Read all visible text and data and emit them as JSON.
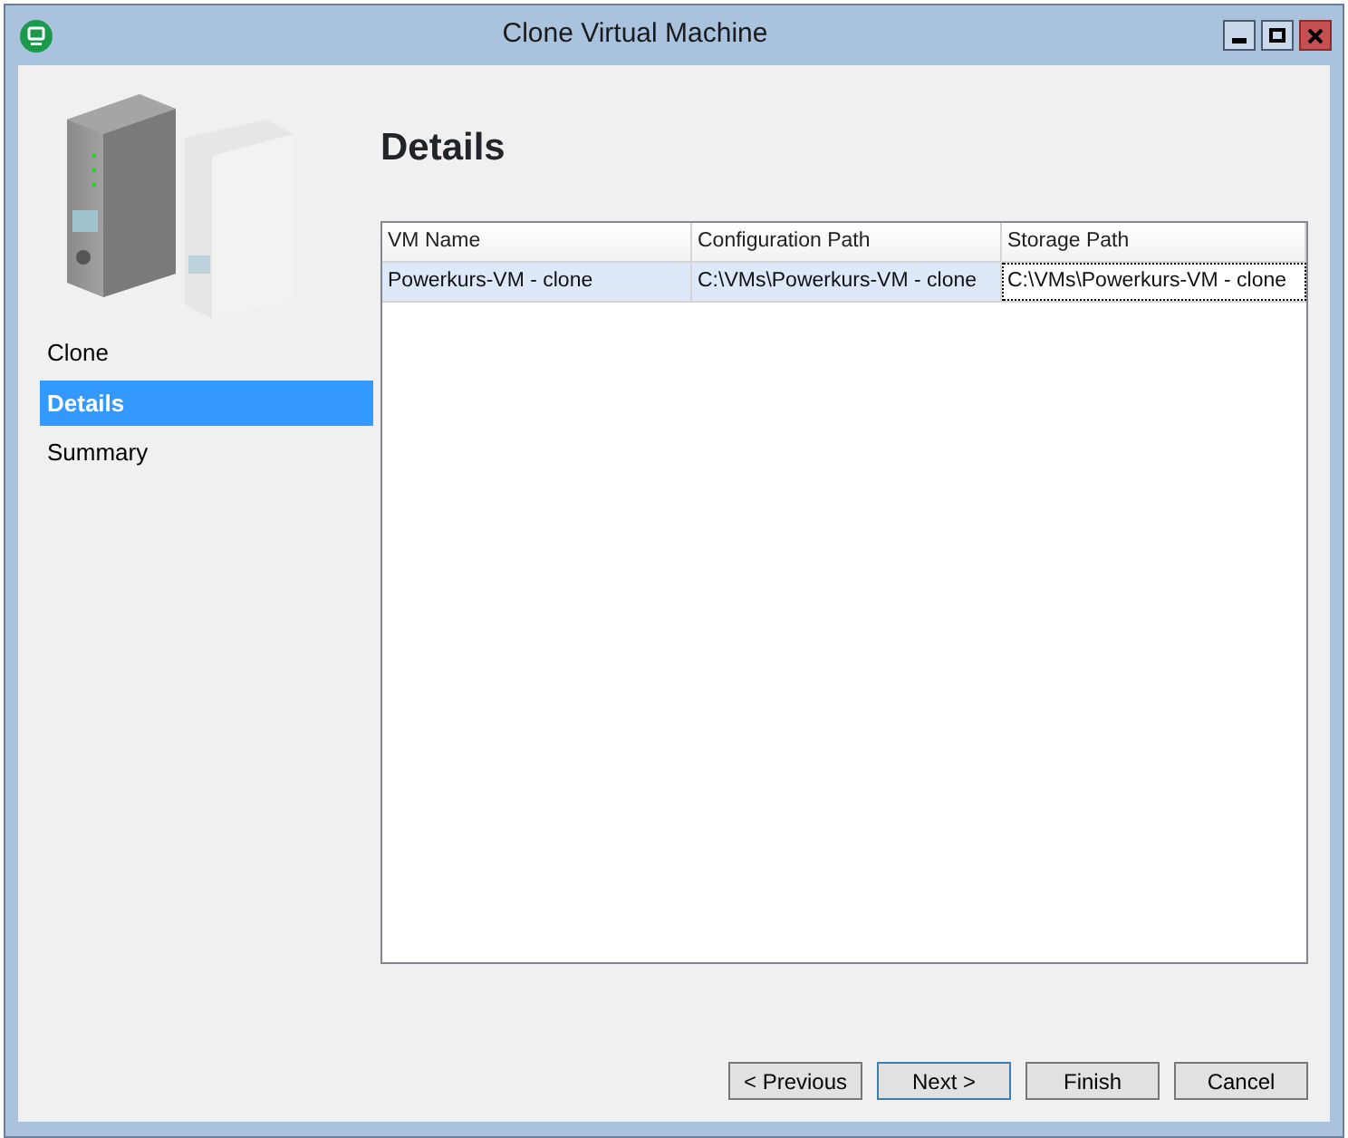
{
  "window": {
    "title": "Clone Virtual Machine"
  },
  "sidebar": {
    "items": [
      {
        "label": "Clone",
        "selected": false
      },
      {
        "label": "Details",
        "selected": true
      },
      {
        "label": "Summary",
        "selected": false
      }
    ]
  },
  "heading": "Details",
  "table": {
    "columns": [
      "VM Name",
      "Configuration Path",
      "Storage Path"
    ],
    "rows": [
      {
        "selected": true,
        "cells": [
          {
            "text": "Powerkurs-VM - clone",
            "focused": false
          },
          {
            "text": "C:\\VMs\\Powerkurs-VM - clone",
            "focused": false
          },
          {
            "text": "C:\\VMs\\Powerkurs-VM - clone",
            "focused": true
          }
        ]
      }
    ]
  },
  "buttons": [
    {
      "label": "< Previous",
      "default": false
    },
    {
      "label": "Next >",
      "default": true
    },
    {
      "label": "Finish",
      "default": false
    },
    {
      "label": "Cancel",
      "default": false
    }
  ]
}
